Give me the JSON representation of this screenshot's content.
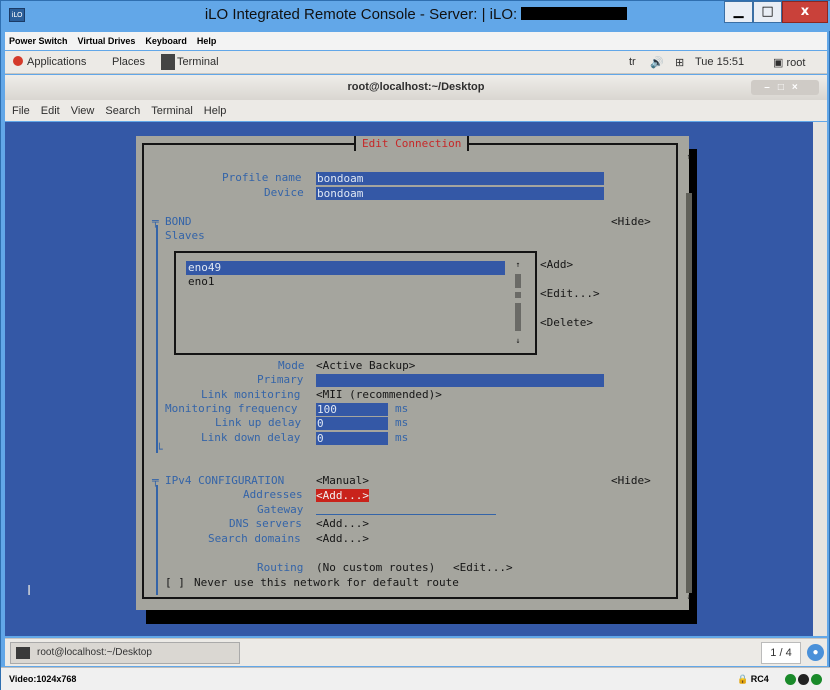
{
  "window": {
    "icon": "iLO",
    "title": "iLO Integrated Remote Console - Server:  | iLO:",
    "buttons": {
      "minimize": "▁",
      "maximize": "□",
      "close": "x"
    }
  },
  "ilo_menu": [
    "Power Switch",
    "Virtual Drives",
    "Keyboard",
    "Help"
  ],
  "gnome_bar": {
    "applications": "Applications",
    "places": "Places",
    "terminal": "Terminal",
    "lang": "tr",
    "clock": "Tue 15:51",
    "user": "root"
  },
  "terminal_window": {
    "title": "root@localhost:~/Desktop",
    "menu": [
      "File",
      "Edit",
      "View",
      "Search",
      "Terminal",
      "Help"
    ]
  },
  "dialog": {
    "caption": "Edit Connection",
    "profile_name_label": "Profile name",
    "profile_name": "bondoam",
    "device_label": "Device",
    "device": "bondoam",
    "bond_label": "BOND",
    "bond_hide": "<Hide>",
    "slaves_label": "Slaves",
    "slaves": [
      "eno49",
      "eno1"
    ],
    "slave_add": "<Add>",
    "slave_edit": "<Edit...>",
    "slave_delete": "<Delete>",
    "mode_label": "Mode",
    "mode": "<Active Backup>",
    "primary_label": "Primary",
    "primary": "",
    "link_monitoring_label": "Link monitoring",
    "link_monitoring": "<MII (recommended)>",
    "monitoring_frequency_label": "Monitoring frequency",
    "monitoring_frequency": "100",
    "link_up_delay_label": "Link up delay",
    "link_up_delay": "0",
    "link_down_delay_label": "Link down delay",
    "link_down_delay": "0",
    "unit_ms": "ms",
    "ipv4_label": "IPv4 CONFIGURATION",
    "ipv4_method": "<Manual>",
    "ipv4_hide": "<Hide>",
    "addresses_label": "Addresses",
    "addresses_add": "<Add...>",
    "gateway_label": "Gateway",
    "gateway": "",
    "dns_label": "DNS servers",
    "dns_add": "<Add...>",
    "search_domains_label": "Search domains",
    "search_domains_add": "<Add...>",
    "routing_label": "Routing",
    "routing_value": "(No custom routes)",
    "routing_edit": "<Edit...>",
    "never_default_checkbox": "[ ]",
    "never_default_label": "Never use this network for default route"
  },
  "taskbar": {
    "task": "root@localhost:~/Desktop",
    "workspace": "1 / 4"
  },
  "statusbar": {
    "video": "Video:1024x768",
    "encryption": "RC4",
    "indicator_colors": [
      "#1a8a2a",
      "#222222",
      "#1a8a2a"
    ]
  }
}
